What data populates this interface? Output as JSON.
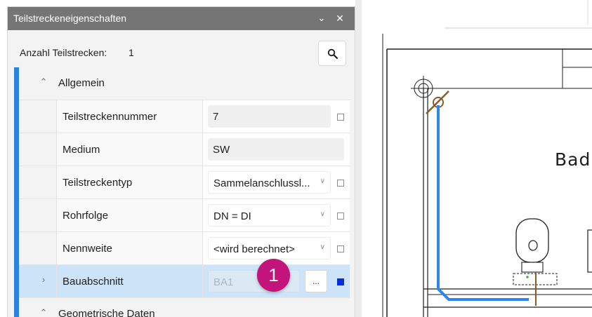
{
  "panel": {
    "title": "Teilstreckeneigenschaften",
    "count_label": "Anzahl Teilstrecken:",
    "count_value": "1"
  },
  "groups": {
    "general": {
      "label": "Allgemein",
      "expanded": true
    },
    "geometry": {
      "label": "Geometrische Daten",
      "expanded": true
    }
  },
  "properties": {
    "segment_number": {
      "label": "Teilstreckennummer",
      "value": "7",
      "checked": false
    },
    "medium": {
      "label": "Medium",
      "value": "SW"
    },
    "segment_type": {
      "label": "Teilstreckentyp",
      "value": "Sammelanschlussl...",
      "checked": false
    },
    "pipe_sequence": {
      "label": "Rohrfolge",
      "value": "DN = DI",
      "checked": false
    },
    "nominal_width": {
      "label": "Nennweite",
      "value": "<wird berechnet>",
      "checked": false
    },
    "construction_section": {
      "label": "Bauabschnitt",
      "value": "BA1",
      "button": "...",
      "checked": true,
      "selected": true
    }
  },
  "callout": {
    "number": "1",
    "color": "#c2147a"
  },
  "drawing": {
    "room_label": "Bad"
  },
  "colors": {
    "accent": "#2c82e0",
    "pipe": "#2f86e8",
    "selection": "#cde3f7",
    "checkbox_active": "#0b2bd6"
  },
  "icons": {
    "search": "search-icon",
    "collapse": "chevron-up-icon",
    "expand": "chevron-right-icon",
    "dropdown": "chevron-down-icon",
    "close": "close-icon"
  }
}
